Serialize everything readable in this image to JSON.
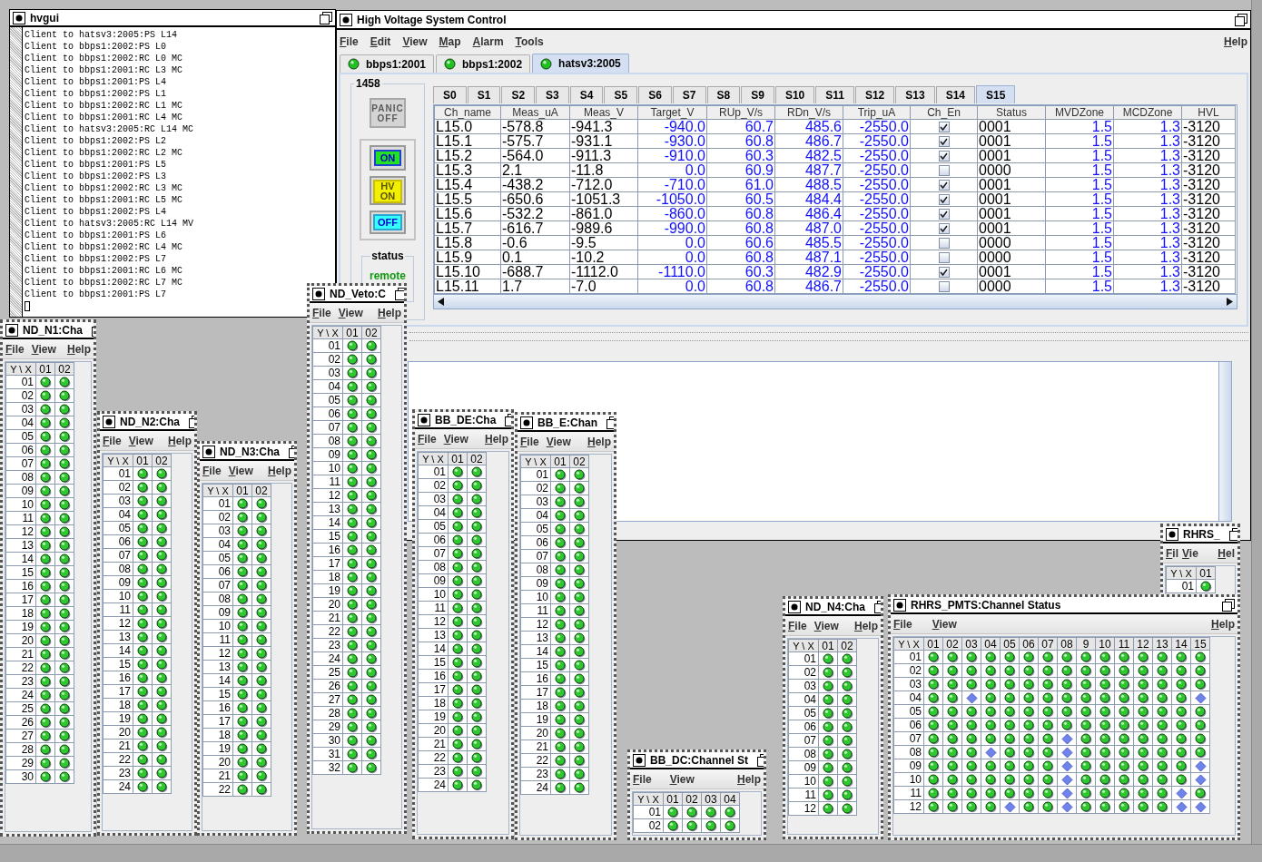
{
  "log_window": {
    "title": "hvgui",
    "lines": [
      "Client to hatsv3:2005:PS L14",
      "Client to bbps1:2002:PS L0",
      "Client to bbps1:2002:RC L0 MC",
      "Client to bbps1:2001:RC L3 MC",
      "Client to bbps1:2001:PS L4",
      "Client to bbps1:2002:PS L1",
      "Client to bbps1:2002:RC L1 MC",
      "Client to bbps1:2001:RC L4 MC",
      "Client to hatsv3:2005:RC L14 MC",
      "Client to bbps1:2002:PS L2",
      "Client to bbps1:2002:RC L2 MC",
      "Client to bbps1:2001:PS L5",
      "Client to bbps1:2002:PS L3",
      "Client to bbps1:2002:RC L3 MC",
      "Client to bbps1:2001:RC L5 MC",
      "Client to bbps1:2002:PS L4",
      "Client to hatsv3:2005:RC L14 MV",
      "Client to bbps1:2001:PS L6",
      "Client to bbps1:2002:RC L4 MC",
      "Client to bbps1:2002:PS L7",
      "Client to bbps1:2001:RC L6 MC",
      "Client to bbps1:2002:RC L7 MC",
      "Client to bbps1:2001:PS L7"
    ]
  },
  "main_window": {
    "title": "High Voltage System Control",
    "menus": [
      "File",
      "Edit",
      "View",
      "Map",
      "Alarm",
      "Tools"
    ],
    "help_menu": "Help",
    "server_tabs": [
      {
        "label": "bbps1:2001",
        "selected": false
      },
      {
        "label": "bbps1:2002",
        "selected": false
      },
      {
        "label": "hatsv3:2005",
        "selected": true
      }
    ],
    "crate": "1458",
    "panic_button": {
      "label": "PANIC OFF",
      "disabled": true
    },
    "power_buttons": [
      {
        "kind": "on",
        "label": "ON"
      },
      {
        "kind": "hv_on",
        "label": "HV ON"
      },
      {
        "kind": "off",
        "label": "OFF"
      }
    ],
    "status": {
      "title": "status",
      "value": "remote"
    },
    "slot_tabs": [
      {
        "label": "S0",
        "selected": false
      },
      {
        "label": "S1",
        "selected": false
      },
      {
        "label": "S2",
        "selected": false
      },
      {
        "label": "S3",
        "selected": false
      },
      {
        "label": "S4",
        "selected": false
      },
      {
        "label": "S5",
        "selected": false
      },
      {
        "label": "S6",
        "selected": false
      },
      {
        "label": "S7",
        "selected": false
      },
      {
        "label": "S8",
        "selected": false
      },
      {
        "label": "S9",
        "selected": false
      },
      {
        "label": "S10",
        "selected": false
      },
      {
        "label": "S11",
        "selected": false
      },
      {
        "label": "S12",
        "selected": false
      },
      {
        "label": "S13",
        "selected": false
      },
      {
        "label": "S14",
        "selected": false
      },
      {
        "label": "S15",
        "selected": true
      }
    ],
    "table": {
      "columns": [
        {
          "label": "Ch_name",
          "kind": "text"
        },
        {
          "label": "Meas_uA",
          "kind": "text"
        },
        {
          "label": "Meas_V",
          "kind": "text"
        },
        {
          "label": "Target_V",
          "kind": "setting"
        },
        {
          "label": "RUp_V/s",
          "kind": "setting"
        },
        {
          "label": "RDn_V/s",
          "kind": "setting"
        },
        {
          "label": "Trip_uA",
          "kind": "setting"
        },
        {
          "label": "Ch_En",
          "kind": "check"
        },
        {
          "label": "Status",
          "kind": "text"
        },
        {
          "label": "MVDZone",
          "kind": "setting"
        },
        {
          "label": "MCDZone",
          "kind": "setting"
        },
        {
          "label": "HVL",
          "kind": "text"
        }
      ],
      "rows": [
        {
          "cells": [
            "L15.0",
            "-578.8",
            "-941.3",
            "-940.0",
            "60.7",
            "485.6",
            "-2550.0",
            true,
            "0001",
            "1.5",
            "1.3",
            "-3120"
          ]
        },
        {
          "cells": [
            "L15.1",
            "-575.7",
            "-931.1",
            "-930.0",
            "60.8",
            "486.7",
            "-2550.0",
            true,
            "0001",
            "1.5",
            "1.3",
            "-3120"
          ]
        },
        {
          "cells": [
            "L15.2",
            "-564.0",
            "-911.3",
            "-910.0",
            "60.3",
            "482.5",
            "-2550.0",
            true,
            "0001",
            "1.5",
            "1.3",
            "-3120"
          ]
        },
        {
          "cells": [
            "L15.3",
            "2.1",
            "-11.8",
            "0.0",
            "60.9",
            "487.7",
            "-2550.0",
            false,
            "0000",
            "1.5",
            "1.3",
            "-3120"
          ]
        },
        {
          "cells": [
            "L15.4",
            "-438.2",
            "-712.0",
            "-710.0",
            "61.0",
            "488.5",
            "-2550.0",
            true,
            "0001",
            "1.5",
            "1.3",
            "-3120"
          ]
        },
        {
          "cells": [
            "L15.5",
            "-650.6",
            "-1051.3",
            "-1050.0",
            "60.5",
            "484.4",
            "-2550.0",
            true,
            "0001",
            "1.5",
            "1.3",
            "-3120"
          ]
        },
        {
          "cells": [
            "L15.6",
            "-532.2",
            "-861.0",
            "-860.0",
            "60.8",
            "486.4",
            "-2550.0",
            true,
            "0001",
            "1.5",
            "1.3",
            "-3120"
          ]
        },
        {
          "cells": [
            "L15.7",
            "-616.7",
            "-989.6",
            "-990.0",
            "60.8",
            "487.0",
            "-2550.0",
            true,
            "0001",
            "1.5",
            "1.3",
            "-3120"
          ]
        },
        {
          "cells": [
            "L15.8",
            "-0.6",
            "-9.5",
            "0.0",
            "60.6",
            "485.5",
            "-2550.0",
            false,
            "0000",
            "1.5",
            "1.3",
            "-3120"
          ]
        },
        {
          "cells": [
            "L15.9",
            "0.1",
            "-10.2",
            "0.0",
            "60.8",
            "487.1",
            "-2550.0",
            false,
            "0000",
            "1.5",
            "1.3",
            "-3120"
          ]
        },
        {
          "cells": [
            "L15.10",
            "-688.7",
            "-1112.0",
            "-1110.0",
            "60.3",
            "482.9",
            "-2550.0",
            true,
            "0001",
            "1.5",
            "1.3",
            "-3120"
          ]
        },
        {
          "cells": [
            "L15.11",
            "1.7",
            "-7.0",
            "0.0",
            "60.8",
            "486.7",
            "-2550.0",
            false,
            "0000",
            "1.5",
            "1.3",
            "-3120"
          ]
        }
      ]
    }
  },
  "status_windows": [
    {
      "title": "ND_N1:Cha",
      "menus": [
        "File",
        "View"
      ],
      "help_menu": "Help",
      "corner": "Y \\ X",
      "columns": [
        "01",
        "02"
      ],
      "rows": [
        {
          "label": "01",
          "on": [
            true,
            true
          ]
        },
        {
          "label": "02",
          "on": [
            true,
            true
          ]
        },
        {
          "label": "03",
          "on": [
            true,
            true
          ]
        },
        {
          "label": "04",
          "on": [
            true,
            true
          ]
        },
        {
          "label": "05",
          "on": [
            true,
            true
          ]
        },
        {
          "label": "06",
          "on": [
            true,
            true
          ]
        },
        {
          "label": "07",
          "on": [
            true,
            true
          ]
        },
        {
          "label": "08",
          "on": [
            true,
            true
          ]
        },
        {
          "label": "09",
          "on": [
            true,
            true
          ]
        },
        {
          "label": "10",
          "on": [
            true,
            true
          ]
        },
        {
          "label": "11",
          "on": [
            true,
            true
          ]
        },
        {
          "label": "12",
          "on": [
            true,
            true
          ]
        },
        {
          "label": "13",
          "on": [
            true,
            true
          ]
        },
        {
          "label": "14",
          "on": [
            true,
            true
          ]
        },
        {
          "label": "15",
          "on": [
            true,
            true
          ]
        },
        {
          "label": "16",
          "on": [
            true,
            true
          ]
        },
        {
          "label": "17",
          "on": [
            true,
            true
          ]
        },
        {
          "label": "18",
          "on": [
            true,
            true
          ]
        },
        {
          "label": "19",
          "on": [
            true,
            true
          ]
        },
        {
          "label": "20",
          "on": [
            true,
            true
          ]
        },
        {
          "label": "21",
          "on": [
            true,
            true
          ]
        },
        {
          "label": "22",
          "on": [
            true,
            true
          ]
        },
        {
          "label": "23",
          "on": [
            true,
            true
          ]
        },
        {
          "label": "24",
          "on": [
            true,
            true
          ]
        },
        {
          "label": "25",
          "on": [
            true,
            true
          ]
        },
        {
          "label": "26",
          "on": [
            true,
            true
          ]
        },
        {
          "label": "27",
          "on": [
            true,
            true
          ]
        },
        {
          "label": "28",
          "on": [
            true,
            true
          ]
        },
        {
          "label": "29",
          "on": [
            true,
            true
          ]
        },
        {
          "label": "30",
          "on": [
            true,
            true
          ]
        }
      ]
    },
    {
      "title": "ND_N2:Cha",
      "menus": [
        "File",
        "View"
      ],
      "help_menu": "Help",
      "corner": "Y \\ X",
      "columns": [
        "01",
        "02"
      ],
      "rows": [
        {
          "label": "01",
          "on": [
            true,
            true
          ]
        },
        {
          "label": "02",
          "on": [
            true,
            true
          ]
        },
        {
          "label": "03",
          "on": [
            true,
            true
          ]
        },
        {
          "label": "04",
          "on": [
            true,
            true
          ]
        },
        {
          "label": "05",
          "on": [
            true,
            true
          ]
        },
        {
          "label": "06",
          "on": [
            true,
            true
          ]
        },
        {
          "label": "07",
          "on": [
            true,
            true
          ]
        },
        {
          "label": "08",
          "on": [
            true,
            true
          ]
        },
        {
          "label": "09",
          "on": [
            true,
            true
          ]
        },
        {
          "label": "10",
          "on": [
            true,
            true
          ]
        },
        {
          "label": "11",
          "on": [
            true,
            true
          ]
        },
        {
          "label": "12",
          "on": [
            true,
            true
          ]
        },
        {
          "label": "13",
          "on": [
            true,
            true
          ]
        },
        {
          "label": "14",
          "on": [
            true,
            true
          ]
        },
        {
          "label": "15",
          "on": [
            true,
            true
          ]
        },
        {
          "label": "16",
          "on": [
            true,
            true
          ]
        },
        {
          "label": "17",
          "on": [
            true,
            true
          ]
        },
        {
          "label": "18",
          "on": [
            true,
            true
          ]
        },
        {
          "label": "19",
          "on": [
            true,
            true
          ]
        },
        {
          "label": "20",
          "on": [
            true,
            true
          ]
        },
        {
          "label": "21",
          "on": [
            true,
            true
          ]
        },
        {
          "label": "22",
          "on": [
            true,
            true
          ]
        },
        {
          "label": "23",
          "on": [
            true,
            true
          ]
        },
        {
          "label": "24",
          "on": [
            true,
            true
          ]
        }
      ]
    },
    {
      "title": "ND_N3:Cha",
      "menus": [
        "File",
        "View"
      ],
      "help_menu": "Help",
      "corner": "Y \\ X",
      "columns": [
        "01",
        "02"
      ],
      "rows": [
        {
          "label": "01",
          "on": [
            true,
            true
          ]
        },
        {
          "label": "02",
          "on": [
            true,
            true
          ]
        },
        {
          "label": "03",
          "on": [
            true,
            true
          ]
        },
        {
          "label": "04",
          "on": [
            true,
            true
          ]
        },
        {
          "label": "05",
          "on": [
            true,
            true
          ]
        },
        {
          "label": "06",
          "on": [
            true,
            true
          ]
        },
        {
          "label": "07",
          "on": [
            true,
            true
          ]
        },
        {
          "label": "08",
          "on": [
            true,
            true
          ]
        },
        {
          "label": "09",
          "on": [
            true,
            true
          ]
        },
        {
          "label": "10",
          "on": [
            true,
            true
          ]
        },
        {
          "label": "11",
          "on": [
            true,
            true
          ]
        },
        {
          "label": "12",
          "on": [
            true,
            true
          ]
        },
        {
          "label": "13",
          "on": [
            true,
            true
          ]
        },
        {
          "label": "14",
          "on": [
            true,
            true
          ]
        },
        {
          "label": "15",
          "on": [
            true,
            true
          ]
        },
        {
          "label": "16",
          "on": [
            true,
            true
          ]
        },
        {
          "label": "17",
          "on": [
            true,
            true
          ]
        },
        {
          "label": "18",
          "on": [
            true,
            true
          ]
        },
        {
          "label": "19",
          "on": [
            true,
            true
          ]
        },
        {
          "label": "20",
          "on": [
            true,
            true
          ]
        },
        {
          "label": "21",
          "on": [
            true,
            true
          ]
        },
        {
          "label": "22",
          "on": [
            true,
            true
          ]
        }
      ]
    },
    {
      "title": "ND_Veto:C",
      "menus": [
        "File",
        "View"
      ],
      "help_menu": "Help",
      "corner": "Y \\ X",
      "columns": [
        "01",
        "02"
      ],
      "rows": [
        {
          "label": "01",
          "on": [
            true,
            true
          ]
        },
        {
          "label": "02",
          "on": [
            true,
            true
          ]
        },
        {
          "label": "03",
          "on": [
            true,
            true
          ]
        },
        {
          "label": "04",
          "on": [
            true,
            true
          ]
        },
        {
          "label": "05",
          "on": [
            true,
            true
          ]
        },
        {
          "label": "06",
          "on": [
            true,
            true
          ]
        },
        {
          "label": "07",
          "on": [
            true,
            true
          ]
        },
        {
          "label": "08",
          "on": [
            true,
            true
          ]
        },
        {
          "label": "09",
          "on": [
            true,
            true
          ]
        },
        {
          "label": "10",
          "on": [
            true,
            true
          ]
        },
        {
          "label": "11",
          "on": [
            true,
            true
          ]
        },
        {
          "label": "12",
          "on": [
            true,
            true
          ]
        },
        {
          "label": "13",
          "on": [
            true,
            true
          ]
        },
        {
          "label": "14",
          "on": [
            true,
            true
          ]
        },
        {
          "label": "15",
          "on": [
            true,
            true
          ]
        },
        {
          "label": "16",
          "on": [
            true,
            true
          ]
        },
        {
          "label": "17",
          "on": [
            true,
            true
          ]
        },
        {
          "label": "18",
          "on": [
            true,
            true
          ]
        },
        {
          "label": "19",
          "on": [
            true,
            true
          ]
        },
        {
          "label": "20",
          "on": [
            true,
            true
          ]
        },
        {
          "label": "21",
          "on": [
            true,
            true
          ]
        },
        {
          "label": "22",
          "on": [
            true,
            true
          ]
        },
        {
          "label": "23",
          "on": [
            true,
            true
          ]
        },
        {
          "label": "24",
          "on": [
            true,
            true
          ]
        },
        {
          "label": "25",
          "on": [
            true,
            true
          ]
        },
        {
          "label": "26",
          "on": [
            true,
            true
          ]
        },
        {
          "label": "27",
          "on": [
            true,
            true
          ]
        },
        {
          "label": "28",
          "on": [
            true,
            true
          ]
        },
        {
          "label": "29",
          "on": [
            true,
            true
          ]
        },
        {
          "label": "30",
          "on": [
            true,
            true
          ]
        },
        {
          "label": "31",
          "on": [
            true,
            true
          ]
        },
        {
          "label": "32",
          "on": [
            true,
            true
          ]
        }
      ]
    },
    {
      "title": "BB_DE:Cha",
      "menus": [
        "File",
        "View"
      ],
      "help_menu": "Help",
      "corner": "Y \\ X",
      "columns": [
        "01",
        "02"
      ],
      "rows": [
        {
          "label": "01",
          "on": [
            true,
            true
          ]
        },
        {
          "label": "02",
          "on": [
            true,
            true
          ]
        },
        {
          "label": "03",
          "on": [
            true,
            true
          ]
        },
        {
          "label": "04",
          "on": [
            true,
            true
          ]
        },
        {
          "label": "05",
          "on": [
            true,
            true
          ]
        },
        {
          "label": "06",
          "on": [
            true,
            true
          ]
        },
        {
          "label": "07",
          "on": [
            true,
            true
          ]
        },
        {
          "label": "08",
          "on": [
            true,
            true
          ]
        },
        {
          "label": "09",
          "on": [
            true,
            true
          ]
        },
        {
          "label": "10",
          "on": [
            true,
            true
          ]
        },
        {
          "label": "11",
          "on": [
            true,
            true
          ]
        },
        {
          "label": "12",
          "on": [
            true,
            true
          ]
        },
        {
          "label": "13",
          "on": [
            true,
            true
          ]
        },
        {
          "label": "14",
          "on": [
            true,
            true
          ]
        },
        {
          "label": "15",
          "on": [
            true,
            true
          ]
        },
        {
          "label": "16",
          "on": [
            true,
            true
          ]
        },
        {
          "label": "17",
          "on": [
            true,
            true
          ]
        },
        {
          "label": "18",
          "on": [
            true,
            true
          ]
        },
        {
          "label": "19",
          "on": [
            true,
            true
          ]
        },
        {
          "label": "20",
          "on": [
            true,
            true
          ]
        },
        {
          "label": "21",
          "on": [
            true,
            true
          ]
        },
        {
          "label": "22",
          "on": [
            true,
            true
          ]
        },
        {
          "label": "23",
          "on": [
            true,
            true
          ]
        },
        {
          "label": "24",
          "on": [
            true,
            true
          ]
        }
      ]
    },
    {
      "title": "BB_E:Chan",
      "menus": [
        "File",
        "View"
      ],
      "help_menu": "Help",
      "corner": "Y \\ X",
      "columns": [
        "01",
        "02"
      ],
      "rows": [
        {
          "label": "01",
          "on": [
            true,
            true
          ]
        },
        {
          "label": "02",
          "on": [
            true,
            true
          ]
        },
        {
          "label": "03",
          "on": [
            true,
            true
          ]
        },
        {
          "label": "04",
          "on": [
            true,
            true
          ]
        },
        {
          "label": "05",
          "on": [
            true,
            true
          ]
        },
        {
          "label": "06",
          "on": [
            true,
            true
          ]
        },
        {
          "label": "07",
          "on": [
            true,
            true
          ]
        },
        {
          "label": "08",
          "on": [
            true,
            true
          ]
        },
        {
          "label": "09",
          "on": [
            true,
            true
          ]
        },
        {
          "label": "10",
          "on": [
            true,
            true
          ]
        },
        {
          "label": "11",
          "on": [
            true,
            true
          ]
        },
        {
          "label": "12",
          "on": [
            true,
            true
          ]
        },
        {
          "label": "13",
          "on": [
            true,
            true
          ]
        },
        {
          "label": "14",
          "on": [
            true,
            true
          ]
        },
        {
          "label": "15",
          "on": [
            true,
            true
          ]
        },
        {
          "label": "16",
          "on": [
            true,
            true
          ]
        },
        {
          "label": "17",
          "on": [
            true,
            true
          ]
        },
        {
          "label": "18",
          "on": [
            true,
            true
          ]
        },
        {
          "label": "19",
          "on": [
            true,
            true
          ]
        },
        {
          "label": "20",
          "on": [
            true,
            true
          ]
        },
        {
          "label": "21",
          "on": [
            true,
            true
          ]
        },
        {
          "label": "22",
          "on": [
            true,
            true
          ]
        },
        {
          "label": "23",
          "on": [
            true,
            true
          ]
        },
        {
          "label": "24",
          "on": [
            true,
            true
          ]
        }
      ]
    },
    {
      "title": "BB_DC:Channel St",
      "menus": [
        "File",
        "View"
      ],
      "help_menu": "Help",
      "corner": "Y \\ X",
      "columns": [
        "01",
        "02",
        "03",
        "04"
      ],
      "rows": [
        {
          "label": "01",
          "on": [
            true,
            true,
            true,
            true
          ]
        },
        {
          "label": "02",
          "on": [
            true,
            true,
            true,
            true
          ]
        }
      ]
    },
    {
      "title": "ND_N4:Cha",
      "menus": [
        "File",
        "View"
      ],
      "help_menu": "Help",
      "corner": "Y \\ X",
      "columns": [
        "01",
        "02"
      ],
      "rows": [
        {
          "label": "01",
          "on": [
            true,
            true
          ]
        },
        {
          "label": "02",
          "on": [
            true,
            true
          ]
        },
        {
          "label": "03",
          "on": [
            true,
            true
          ]
        },
        {
          "label": "04",
          "on": [
            true,
            true
          ]
        },
        {
          "label": "05",
          "on": [
            true,
            true
          ]
        },
        {
          "label": "06",
          "on": [
            true,
            true
          ]
        },
        {
          "label": "07",
          "on": [
            true,
            true
          ]
        },
        {
          "label": "08",
          "on": [
            true,
            true
          ]
        },
        {
          "label": "09",
          "on": [
            true,
            true
          ]
        },
        {
          "label": "10",
          "on": [
            true,
            true
          ]
        },
        {
          "label": "11",
          "on": [
            true,
            true
          ]
        },
        {
          "label": "12",
          "on": [
            true,
            true
          ]
        }
      ]
    },
    {
      "title": "RHRS_",
      "menus": [
        "Fil",
        "Vie"
      ],
      "help_menu": "Hel",
      "corner": "Y \\ X",
      "columns": [
        "01"
      ],
      "rows": [
        {
          "label": "01",
          "on": [
            true
          ]
        }
      ]
    },
    {
      "title": "RHRS_PMTS:Channel Status",
      "menus": [
        "File",
        "View"
      ],
      "help_menu": "Help",
      "corner": "Y \\ X",
      "columns": [
        "01",
        "02",
        "03",
        "04",
        "05",
        "06",
        "07",
        "08",
        "9",
        "10",
        "11",
        "12",
        "13",
        "14",
        "15"
      ],
      "rows": [
        {
          "label": "01",
          "on": [
            true,
            true,
            true,
            true,
            true,
            true,
            true,
            true,
            true,
            true,
            true,
            true,
            true,
            true,
            true
          ]
        },
        {
          "label": "02",
          "on": [
            true,
            true,
            true,
            true,
            true,
            true,
            true,
            true,
            true,
            true,
            true,
            true,
            true,
            true,
            true
          ]
        },
        {
          "label": "03",
          "on": [
            true,
            true,
            true,
            true,
            true,
            true,
            true,
            true,
            true,
            true,
            true,
            true,
            true,
            true,
            true
          ]
        },
        {
          "label": "04",
          "on": [
            true,
            true,
            false,
            true,
            true,
            true,
            true,
            true,
            true,
            true,
            true,
            true,
            true,
            true,
            false
          ]
        },
        {
          "label": "05",
          "on": [
            true,
            true,
            true,
            true,
            true,
            true,
            true,
            true,
            true,
            true,
            true,
            true,
            true,
            true,
            true
          ]
        },
        {
          "label": "06",
          "on": [
            true,
            true,
            true,
            true,
            true,
            true,
            true,
            true,
            true,
            true,
            true,
            true,
            true,
            true,
            true
          ]
        },
        {
          "label": "07",
          "on": [
            true,
            true,
            true,
            true,
            true,
            true,
            true,
            false,
            true,
            true,
            true,
            true,
            true,
            true,
            true
          ]
        },
        {
          "label": "08",
          "on": [
            true,
            true,
            true,
            false,
            true,
            true,
            true,
            false,
            true,
            true,
            true,
            true,
            true,
            true,
            true
          ]
        },
        {
          "label": "09",
          "on": [
            true,
            true,
            true,
            true,
            true,
            true,
            true,
            false,
            true,
            true,
            true,
            true,
            true,
            true,
            false
          ]
        },
        {
          "label": "10",
          "on": [
            true,
            true,
            true,
            true,
            true,
            true,
            true,
            false,
            true,
            true,
            true,
            true,
            true,
            true,
            false
          ]
        },
        {
          "label": "11",
          "on": [
            true,
            true,
            true,
            true,
            true,
            true,
            true,
            false,
            true,
            true,
            true,
            true,
            true,
            false,
            true
          ]
        },
        {
          "label": "12",
          "on": [
            true,
            true,
            true,
            true,
            false,
            true,
            true,
            false,
            true,
            true,
            true,
            true,
            true,
            false,
            false
          ]
        }
      ]
    }
  ]
}
